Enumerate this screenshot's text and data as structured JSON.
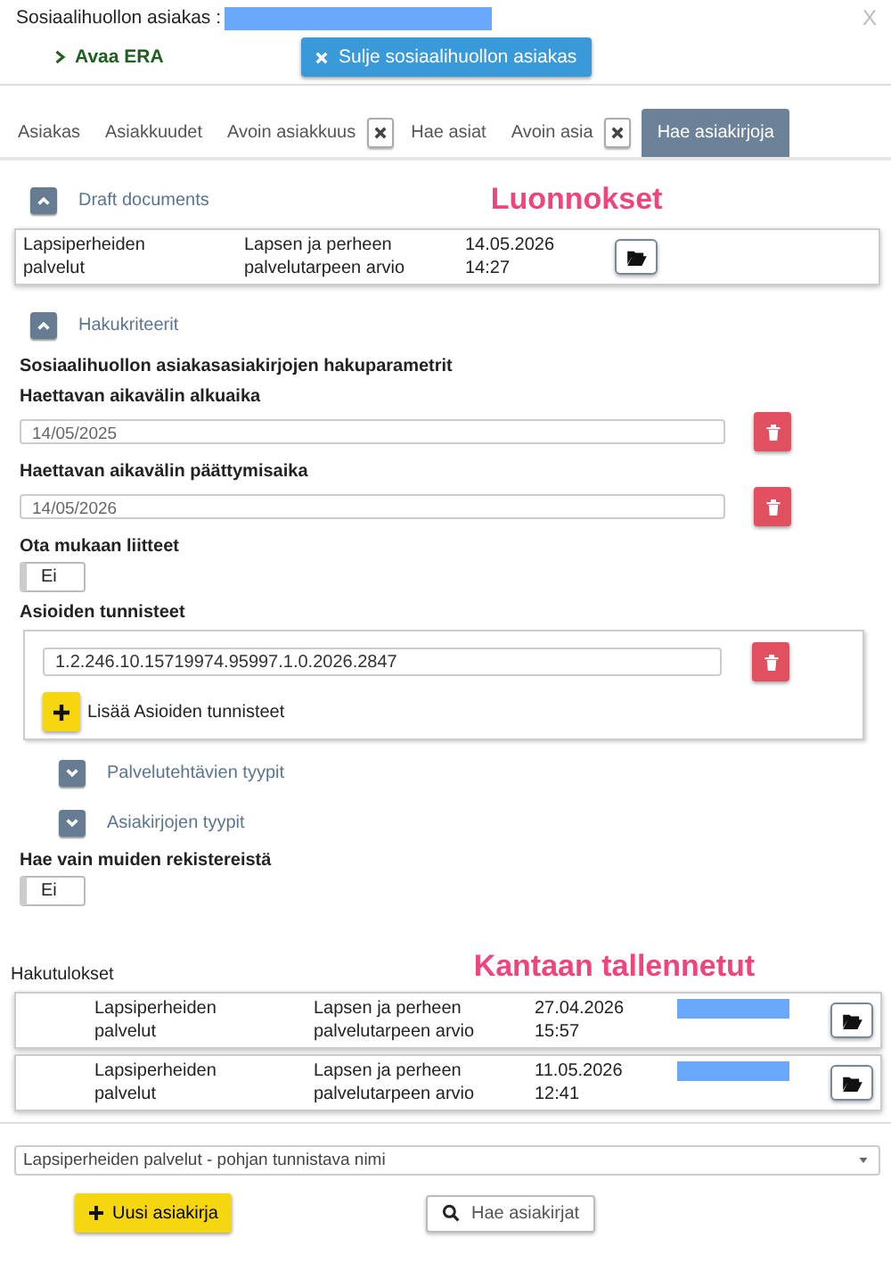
{
  "window": {
    "title": "Sosiaalihuollon asiakas :",
    "close": "X"
  },
  "actions": {
    "link": "Avaa ERA",
    "button": "Sulje sosiaalihuollon asiakas"
  },
  "tabs": [
    {
      "label": "Asiakas",
      "selected": false,
      "closable": false
    },
    {
      "label": "Asiakkuudet",
      "selected": false,
      "closable": false
    },
    {
      "label": "Avoin asiakkuus",
      "selected": false,
      "closable": true
    },
    {
      "label": "Hae asiat",
      "selected": false,
      "closable": false
    },
    {
      "label": "Avoin asia",
      "selected": false,
      "closable": true
    },
    {
      "label": "Hae asiakirjoja",
      "selected": true,
      "closable": false
    }
  ],
  "drafts": {
    "title": "Draft documents",
    "expanded": true,
    "annotation": "Luonnokset",
    "rows": [
      {
        "service": "Lapsiperheiden palvelut",
        "document": "Lapsen ja perheen palvelutarpeen arvio",
        "date": "14.05.2026",
        "time": "14:27"
      }
    ]
  },
  "criteria": {
    "title": "Hakukriteerit",
    "expanded": true,
    "heading": "Sosiaalihuollon asiakasasiakirjojen hakuparametrit",
    "start": {
      "label": "Haettavan aikavälin alkuaika",
      "value": "14/05/2025"
    },
    "end": {
      "label": "Haettavan aikavälin päättymisaika",
      "value": "14/05/2026"
    },
    "attachments": {
      "label": "Ota mukaan liitteet",
      "on": false,
      "text": "Ei"
    },
    "ids": {
      "label": "Asioiden tunnisteet",
      "values": [
        "1.2.246.10.15719974.95997.1.0.2026.2847"
      ],
      "add": "Lisää Asioiden tunnisteet"
    },
    "subsections": [
      {
        "title": "Palvelutehtävien tyypit",
        "expanded": false
      },
      {
        "title": "Asiakirjojen tyypit",
        "expanded": false
      }
    ],
    "others": {
      "label": "Hae vain muiden rekistereistä",
      "on": false,
      "text": "Ei"
    }
  },
  "results": {
    "title": "Hakutulokset",
    "annotation": "Kantaan tallennetut",
    "rows": [
      {
        "service": "Lapsiperheiden palvelut",
        "document": "Lapsen ja perheen palvelutarpeen arvio",
        "date": "27.04.2026",
        "time": "15:57"
      },
      {
        "service": "Lapsiperheiden palvelut",
        "document": "Lapsen ja perheen palvelutarpeen arvio",
        "date": "11.05.2026",
        "time": "12:41"
      }
    ]
  },
  "template_select": {
    "value": "Lapsiperheiden palvelut - pohjan tunnistava nimi"
  },
  "buttons": {
    "new": "Uusi asiakirja",
    "search": "Hae asiakirjat"
  }
}
